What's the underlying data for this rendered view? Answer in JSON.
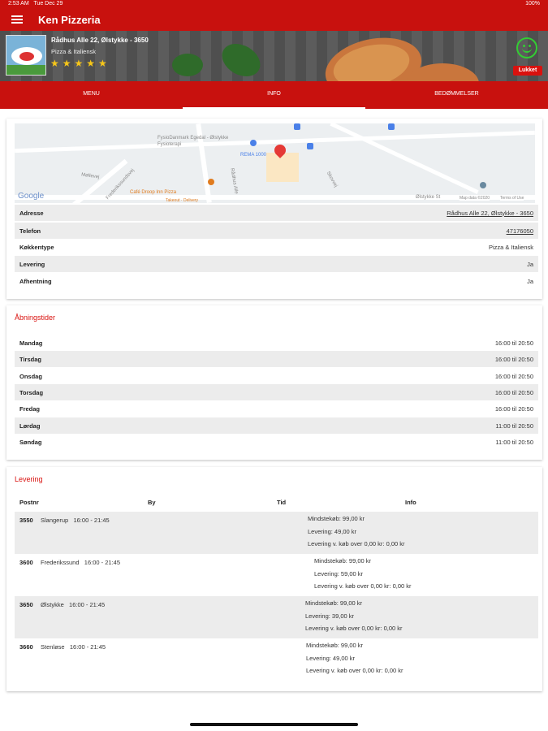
{
  "status": {
    "time": "2:53 AM",
    "date": "Tue Dec 29",
    "battery": "100%"
  },
  "appbar": {
    "title": "Ken Pizzeria",
    "menu_icon": "hamburger-icon"
  },
  "restaurant": {
    "address_line": "Rådhus Alle 22, Ølstykke - 3650",
    "cuisine": "Pizza & Italiensk",
    "stars": "★★★★★",
    "status_label": "Lukket",
    "status_icon": "smiley-icon"
  },
  "tabs": [
    {
      "label": "MENU"
    },
    {
      "label": "INFO"
    },
    {
      "label": "BEDØMMELSER"
    }
  ],
  "map": {
    "labels": [
      "FysioDanmark Egedal - Ølstykke Fysioterapi",
      "REMA 1000",
      "Café Droop Inn Pizza",
      "Takeout · Delivery",
      "Møllevej",
      "Frederikssundsvej",
      "Rådhus Alle",
      "Skovvej",
      "Ølstykke St",
      "Map data ©2020",
      "Terms of Use",
      "Google"
    ],
    "pin_icon": "map-pin-icon"
  },
  "info": [
    {
      "key": "Adresse",
      "value": "Rådhus Alle 22, Ølstykke - 3650"
    },
    {
      "key": "Telefon",
      "value": "47176050"
    },
    {
      "key": "Køkkentype",
      "value": "Pizza & Italiensk"
    },
    {
      "key": "Levering",
      "value": "Ja"
    },
    {
      "key": "Afhentning",
      "value": "Ja"
    }
  ],
  "hours": {
    "title": "Åbningstider",
    "rows": [
      {
        "day": "Mandag",
        "time": "16:00 til 20:50"
      },
      {
        "day": "Tirsdag",
        "time": "16:00 til 20:50"
      },
      {
        "day": "Onsdag",
        "time": "16:00 til 20:50"
      },
      {
        "day": "Torsdag",
        "time": "16:00 til 20:50"
      },
      {
        "day": "Fredag",
        "time": "16:00 til 20:50"
      },
      {
        "day": "Lørdag",
        "time": "11:00 til 20:50"
      },
      {
        "day": "Søndag",
        "time": "11:00 til 20:50"
      }
    ]
  },
  "delivery": {
    "title": "Levering",
    "headers": {
      "postnr": "Postnr",
      "by": "By",
      "tid": "Tid",
      "info": "Info"
    },
    "rows": [
      {
        "postnr": "3550",
        "city": "Slangerup",
        "time": "16:00 - 21:45",
        "min": "Mindstekøb: 99,00 kr",
        "fee": "Levering: 49,00 kr",
        "free": "Levering v. køb over 0,00 kr: 0,00 kr"
      },
      {
        "postnr": "3600",
        "city": "Frederikssund",
        "time": "16:00 - 21:45",
        "min": "Mindstekøb: 99,00 kr",
        "fee": "Levering: 59,00 kr",
        "free": "Levering v. køb over 0,00 kr: 0,00 kr"
      },
      {
        "postnr": "3650",
        "city": "Ølstykke",
        "time": "16:00 - 21:45",
        "min": "Mindstekøb: 99,00 kr",
        "fee": "Levering: 39,00 kr",
        "free": "Levering v. køb over 0,00 kr: 0,00 kr"
      },
      {
        "postnr": "3660",
        "city": "Stenløse",
        "time": "16:00 - 21:45",
        "min": "Mindstekøb: 99,00 kr",
        "fee": "Levering: 49,00 kr",
        "free": "Levering v. køb over 0,00 kr: 0,00 kr"
      }
    ]
  },
  "colors": {
    "brand": "#c8110e",
    "accent_title": "#d9110e",
    "stars": "#f6c619",
    "open_smiley": "#33cc33"
  }
}
